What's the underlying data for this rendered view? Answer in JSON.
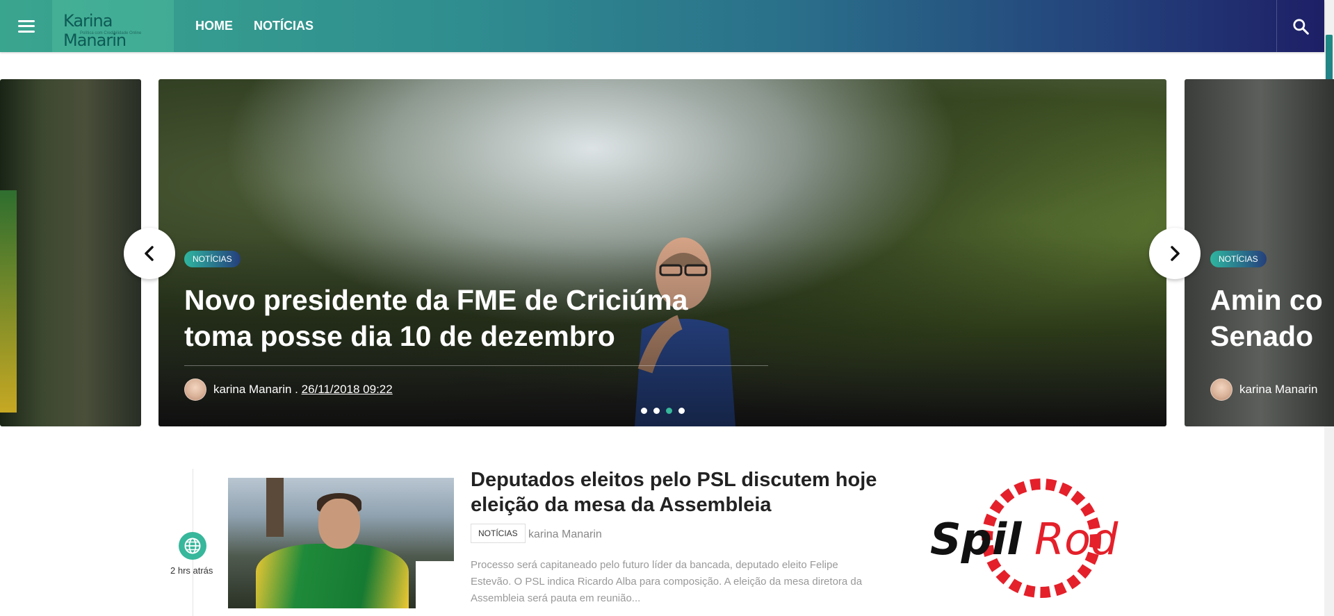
{
  "header": {
    "logo_title": "Karina Manarin",
    "logo_subtitle": "Política com Credibilidade Online",
    "nav": [
      "HOME",
      "NOTÍCIAS"
    ]
  },
  "slider": {
    "main": {
      "category": "NOTÍCIAS",
      "title_line1": "Novo presidente da FME de Criciúma",
      "title_line2": "toma posse dia 10 de dezembro",
      "author": "karina Manarin .",
      "date": "26/11/2018 09:22"
    },
    "next": {
      "category": "NOTÍCIAS",
      "title_line1": "Amin co",
      "title_line2": "Senado",
      "author": "karina Manarin"
    },
    "dots_count": 4,
    "active_dot": 3
  },
  "article": {
    "time_ago": "2 hrs atrás",
    "title": "Deputados eleitos pelo PSL discutem hoje eleição da mesa da Assembleia",
    "category": "NOTÍCIAS",
    "author": "karina Manarin",
    "excerpt": "Processo será capitaneado pelo futuro líder da bancada, deputado eleito Felipe Estevão. O PSL indica Ricardo Alba para composição. A eleição da mesa diretora da Assembleia será pauta em reunião..."
  },
  "ad": {
    "brand_part1": "Spil",
    "brand_part2": "Rod"
  },
  "colors": {
    "accent": "#37b79b",
    "header_dark": "#1e1f66",
    "ad_red": "#e4202a"
  },
  "icons": [
    "menu-icon",
    "search-icon",
    "chevron-left-icon",
    "chevron-right-icon",
    "globe-icon"
  ]
}
